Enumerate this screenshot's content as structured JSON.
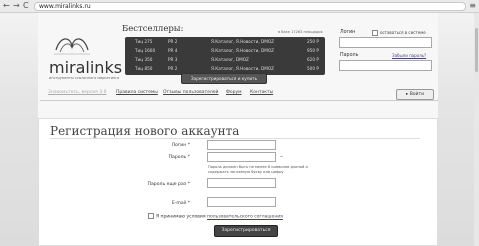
{
  "browser": {
    "back": "←",
    "forward": "→",
    "reload": "C",
    "url": "www.miralinks.ru",
    "menu": "≡"
  },
  "logo": {
    "name": "miralinks",
    "tagline": "инструменты ссылочного маркетинга"
  },
  "bestsellers": {
    "title": "Бестселлеры:",
    "note": "в базе 17263 площадок",
    "rows": [
      {
        "tic": "Тиц 275",
        "pr": "PR 2",
        "catalog": "Я.Каталог, Я.Новости, DMOZ",
        "price": "250 Р"
      },
      {
        "tic": "Тиц 1600",
        "pr": "PR 4",
        "catalog": "Я.Каталог, Я.Новости, DMOZ",
        "price": "950 Р"
      },
      {
        "tic": "Тиц 350",
        "pr": "PR 3",
        "catalog": "Я.Каталог, DMOZ",
        "price": "620 Р"
      },
      {
        "tic": "Тиц 850",
        "pr": "PR 2",
        "catalog": "Я.Каталог, Я.Новости, DMOZ",
        "price": "500 Р"
      }
    ],
    "button": "Зарегистрироваться и купить"
  },
  "login": {
    "login_label": "Логин",
    "remember": "оставаться в системе",
    "password_label": "Пароль",
    "forgot": "Забыли пароль?",
    "button": "Войти"
  },
  "nav": [
    {
      "label": "Знакомьтесь, версия 3.0"
    },
    {
      "label": "Правила системы"
    },
    {
      "label": "Отзывы пользователей"
    },
    {
      "label": "Форум"
    },
    {
      "label": "Контакты"
    }
  ],
  "form": {
    "title": "Регистрация нового аккаунта",
    "login_label": "Логин *",
    "password_label": "Пароль *",
    "password_hint": "Пароль должен быть не менее 8 символов длиной и содержать заглавную букву или цифру",
    "password2_label": "Пароль еще раз *",
    "email_label": "E-mail *",
    "agree_prefix": "Я принимаю условия",
    "agree_link": "пользовательского соглашения",
    "submit": "Зарегистрироваться"
  }
}
